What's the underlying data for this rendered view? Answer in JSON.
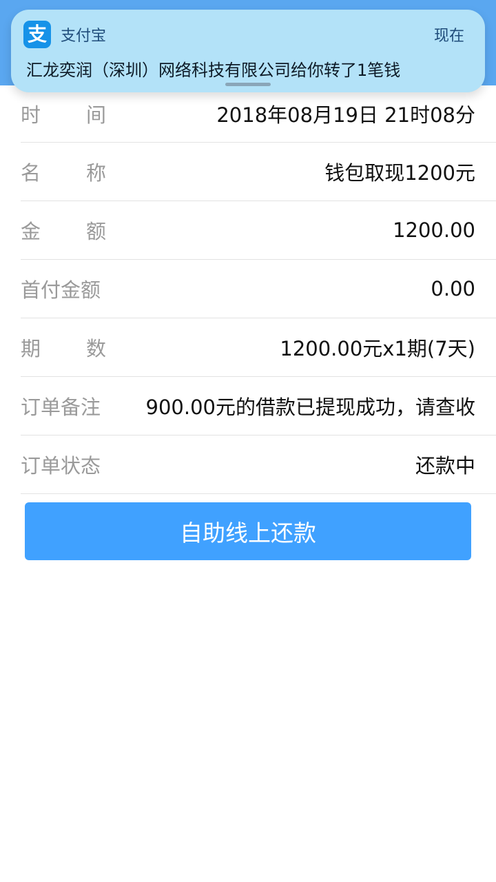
{
  "notification": {
    "app_name": "支付宝",
    "icon_char": "支",
    "time": "现在",
    "message": "汇龙奕润（深圳）网络科技有限公司给你转了1笔钱"
  },
  "details": [
    {
      "label_chars": [
        "时",
        "间"
      ],
      "label": "时间",
      "value": "2018年08月19日 21时08分"
    },
    {
      "label_chars": [
        "名",
        "称"
      ],
      "label": "名称",
      "value": "钱包取现1200元"
    },
    {
      "label_chars": [
        "金",
        "额"
      ],
      "label": "金额",
      "value": "1200.00"
    },
    {
      "label": "首付金额",
      "value": "0.00"
    },
    {
      "label_chars": [
        "期",
        "数"
      ],
      "label": "期数",
      "value": "1200.00元x1期(7天)"
    },
    {
      "label": "订单备注",
      "value": "900.00元的借款已提现成功，请查收"
    },
    {
      "label": "订单状态",
      "value": "还款中"
    }
  ],
  "action": {
    "repay_button_label": "自助线上还款"
  },
  "colors": {
    "accent": "#40a1ff",
    "header": "#5aa7f0",
    "notification_bg": "#b3e2f8",
    "alipay_blue": "#1692e8"
  }
}
